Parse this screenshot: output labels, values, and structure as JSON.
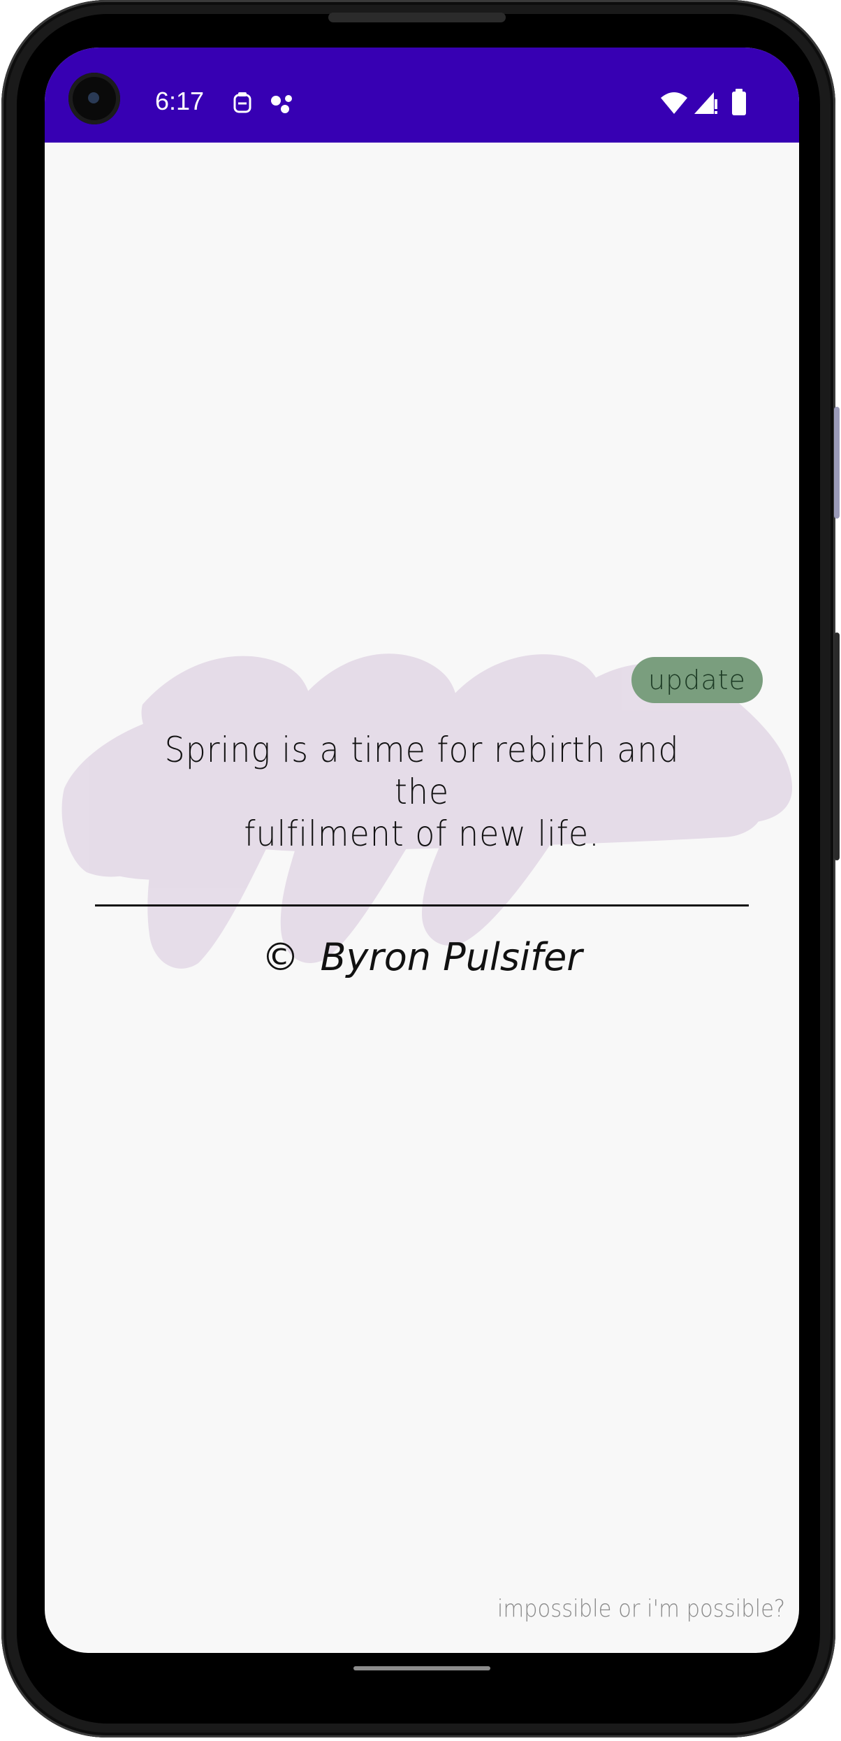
{
  "status_bar": {
    "time": "6:17",
    "color": "#3700b3",
    "left_icons": [
      "notification-icon",
      "assistant-dots-icon"
    ],
    "right_icons": [
      "wifi-icon",
      "cell-signal-icon",
      "battery-icon"
    ]
  },
  "card": {
    "update_label": "update",
    "update_color": "#7a9e7e",
    "quote_line_1": "Spring is a time for rebirth and the",
    "quote_line_2": "fulfilment of new life.",
    "copyright_symbol": "©",
    "author": "Byron Pulsifer",
    "brush_color": "#e5dbe8"
  },
  "footer": {
    "tagline": "impossible or i'm possible?"
  }
}
